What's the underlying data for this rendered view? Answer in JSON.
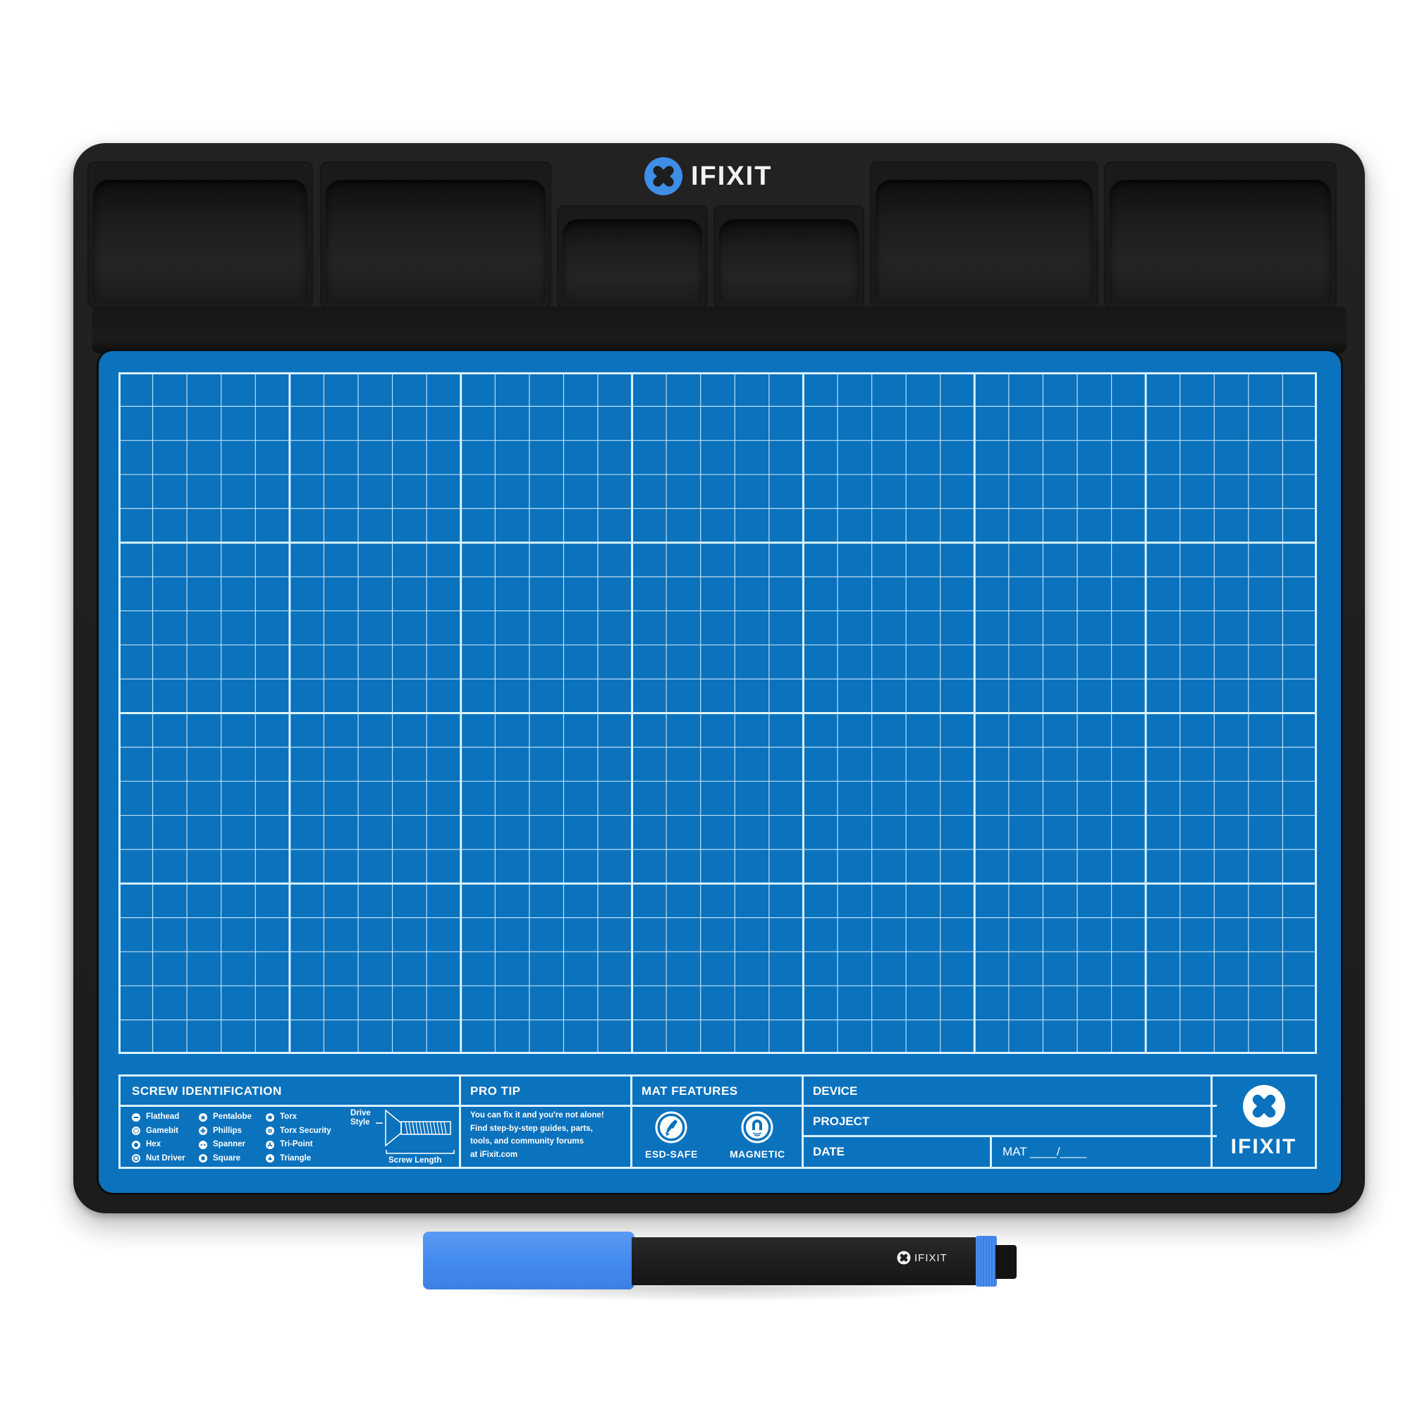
{
  "tray": {
    "brand": "IFIXIT",
    "compartments": [
      "bin-1",
      "bin-2",
      "bin-3",
      "bin-4",
      "bin-5",
      "bin-6"
    ]
  },
  "mat": {
    "grid": {
      "major_columns": 7,
      "major_rows": 4,
      "minor_per_major": 5
    },
    "colors": {
      "mat_blue": "#0b72bd",
      "line": "#d9f2ff",
      "tray_black": "#1e1e1f",
      "brand_blue": "#3f8ee6"
    }
  },
  "info_panel": {
    "screw_identification": {
      "title": "SCREW IDENTIFICATION",
      "columns": [
        [
          {
            "icon": "flathead-icon",
            "label": "Flathead"
          },
          {
            "icon": "gamebit-icon",
            "label": "Gamebit"
          },
          {
            "icon": "hex-icon",
            "label": "Hex"
          },
          {
            "icon": "nut-driver-icon",
            "label": "Nut Driver"
          }
        ],
        [
          {
            "icon": "pentalobe-icon",
            "label": "Pentalobe"
          },
          {
            "icon": "phillips-icon",
            "label": "Phillips"
          },
          {
            "icon": "spanner-icon",
            "label": "Spanner"
          },
          {
            "icon": "square-icon",
            "label": "Square"
          }
        ],
        [
          {
            "icon": "torx-icon",
            "label": "Torx"
          },
          {
            "icon": "torx-security-icon",
            "label": "Torx Security"
          },
          {
            "icon": "tri-point-icon",
            "label": "Tri-Point"
          },
          {
            "icon": "triangle-icon",
            "label": "Triangle"
          }
        ]
      ],
      "diagram": {
        "drive_style_line1": "Drive",
        "drive_style_line2": "Style",
        "screw_length": "Screw Length"
      }
    },
    "pro_tip": {
      "title": "PRO TIP",
      "line1": "You can fix it and you're not alone!",
      "line2": "Find step-by-step guides, parts,",
      "line3": "tools, and community forums",
      "line4_prefix": "at ",
      "line4_link": "iFixit.com"
    },
    "mat_features": {
      "title": "MAT FEATURES",
      "items": [
        {
          "icon": "esd-safe-icon",
          "label": "ESD-SAFE"
        },
        {
          "icon": "magnetic-icon",
          "label": "MAGNETIC"
        }
      ]
    },
    "fields": {
      "device": "DEVICE",
      "project": "PROJECT",
      "date": "DATE",
      "mat": "MAT ____/____"
    },
    "brand": "IFIXIT"
  },
  "marker": {
    "brand": "IFIXIT"
  }
}
